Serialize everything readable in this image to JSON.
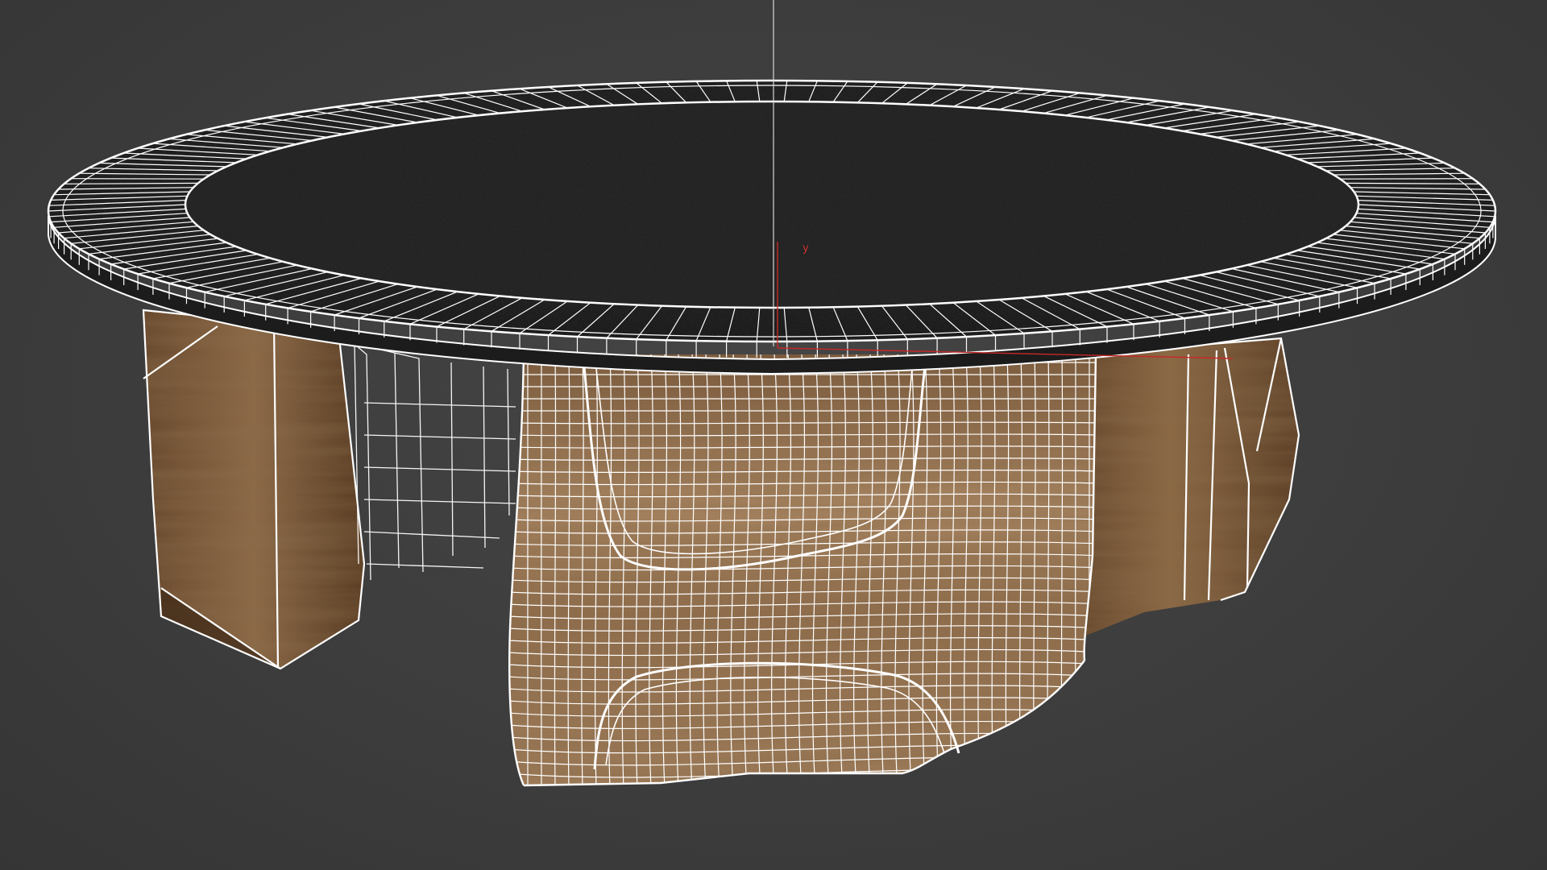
{
  "viewport": {
    "background_color": "#3c3c3c",
    "wire_color": "#ffffff",
    "axis_color": "#c82828",
    "pivot_line_color": "#d8d8d8"
  },
  "model": {
    "tabletop_material": "dark-granite",
    "base_material": "walnut-wood",
    "selection_state": "wireframe-on-shaded"
  },
  "gizmo": {
    "axis_y_label": "y",
    "axis_x_label": ""
  }
}
